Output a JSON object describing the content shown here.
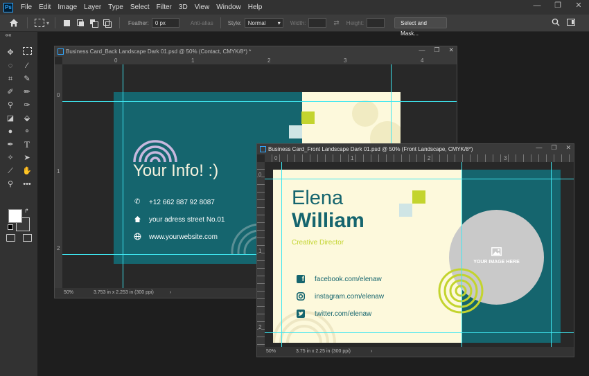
{
  "menubar": {
    "logo": "Ps",
    "items": [
      "File",
      "Edit",
      "Image",
      "Layer",
      "Type",
      "Select",
      "Filter",
      "3D",
      "View",
      "Window",
      "Help"
    ],
    "controls": [
      "—",
      "❐",
      "✕"
    ]
  },
  "options": {
    "feather_label": "Feather:",
    "feather_value": "0 px",
    "antialias_label": "Anti-alias",
    "style_label": "Style:",
    "style_value": "Normal",
    "width_label": "Width:",
    "height_label": "Height:",
    "select_mask_label": "Select and Mask..."
  },
  "back_doc": {
    "title": "Business Card_Back Landscape Dark 01.psd @ 50% (Contact, CMYK/8*) *",
    "ruler_h": [
      "0",
      "1",
      "2",
      "3",
      "4"
    ],
    "ruler_v": [
      "0",
      "1",
      "2"
    ],
    "heading": "Your Info! :)",
    "phone": "+12 662 887 92 8087",
    "address": "your adress street No.01",
    "website": "www.yourwebsite.com",
    "zoom": "50%",
    "dimensions": "3.753 in x 2.253 in (300 ppi)"
  },
  "front_doc": {
    "title": "Business Card_Front Landscape Dark 01.psd @ 50% (Front Landscape, CMYK/8*)",
    "ruler_h": [
      "0",
      "1",
      "2",
      "3"
    ],
    "ruler_v": [
      "0",
      "1",
      "2"
    ],
    "first_name": "Elena",
    "last_name": "William",
    "role": "Creative Director",
    "facebook": "facebook.com/elenaw",
    "instagram": "instagram.com/elenaw",
    "twitter": "twitter.com/elenaw",
    "image_placeholder": "YOUR IMAGE HERE",
    "zoom": "50%",
    "dimensions": "3.75 in x 2.25 in (300 ppi)"
  },
  "colors": {
    "teal": "#15656e",
    "cream": "#fdf9dc",
    "lime": "#c3d42e",
    "guide": "#3ee6f0"
  }
}
